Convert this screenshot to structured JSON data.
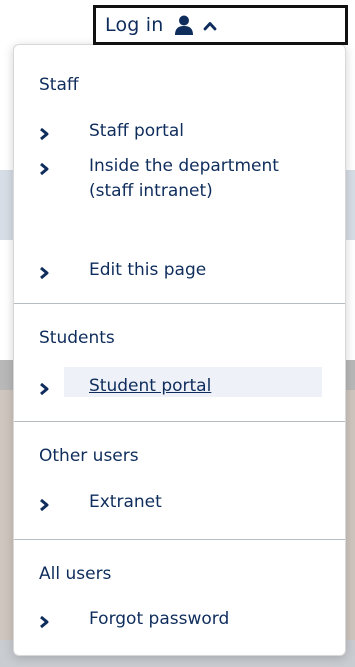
{
  "login": {
    "label": "Log in",
    "icons": [
      "user-icon",
      "caret-up-icon"
    ]
  },
  "menu": {
    "sections": [
      {
        "heading": "Staff",
        "items": [
          {
            "label": "Staff portal"
          },
          {
            "label": "Inside the department (staff intranet)"
          },
          {
            "label": "Edit this page"
          }
        ]
      },
      {
        "heading": "Students",
        "items": [
          {
            "label": "Student portal",
            "active": true
          }
        ]
      },
      {
        "heading": "Other users",
        "items": [
          {
            "label": "Extranet"
          }
        ]
      },
      {
        "heading": "All users",
        "items": [
          {
            "label": "Forgot password"
          }
        ]
      }
    ]
  },
  "colors": {
    "text": "#0f2d5c",
    "border": "#111111",
    "divider": "#b7bcc4",
    "active_bg": "#eef1f7"
  },
  "icons": {
    "chevron": "chevron-right-icon"
  }
}
